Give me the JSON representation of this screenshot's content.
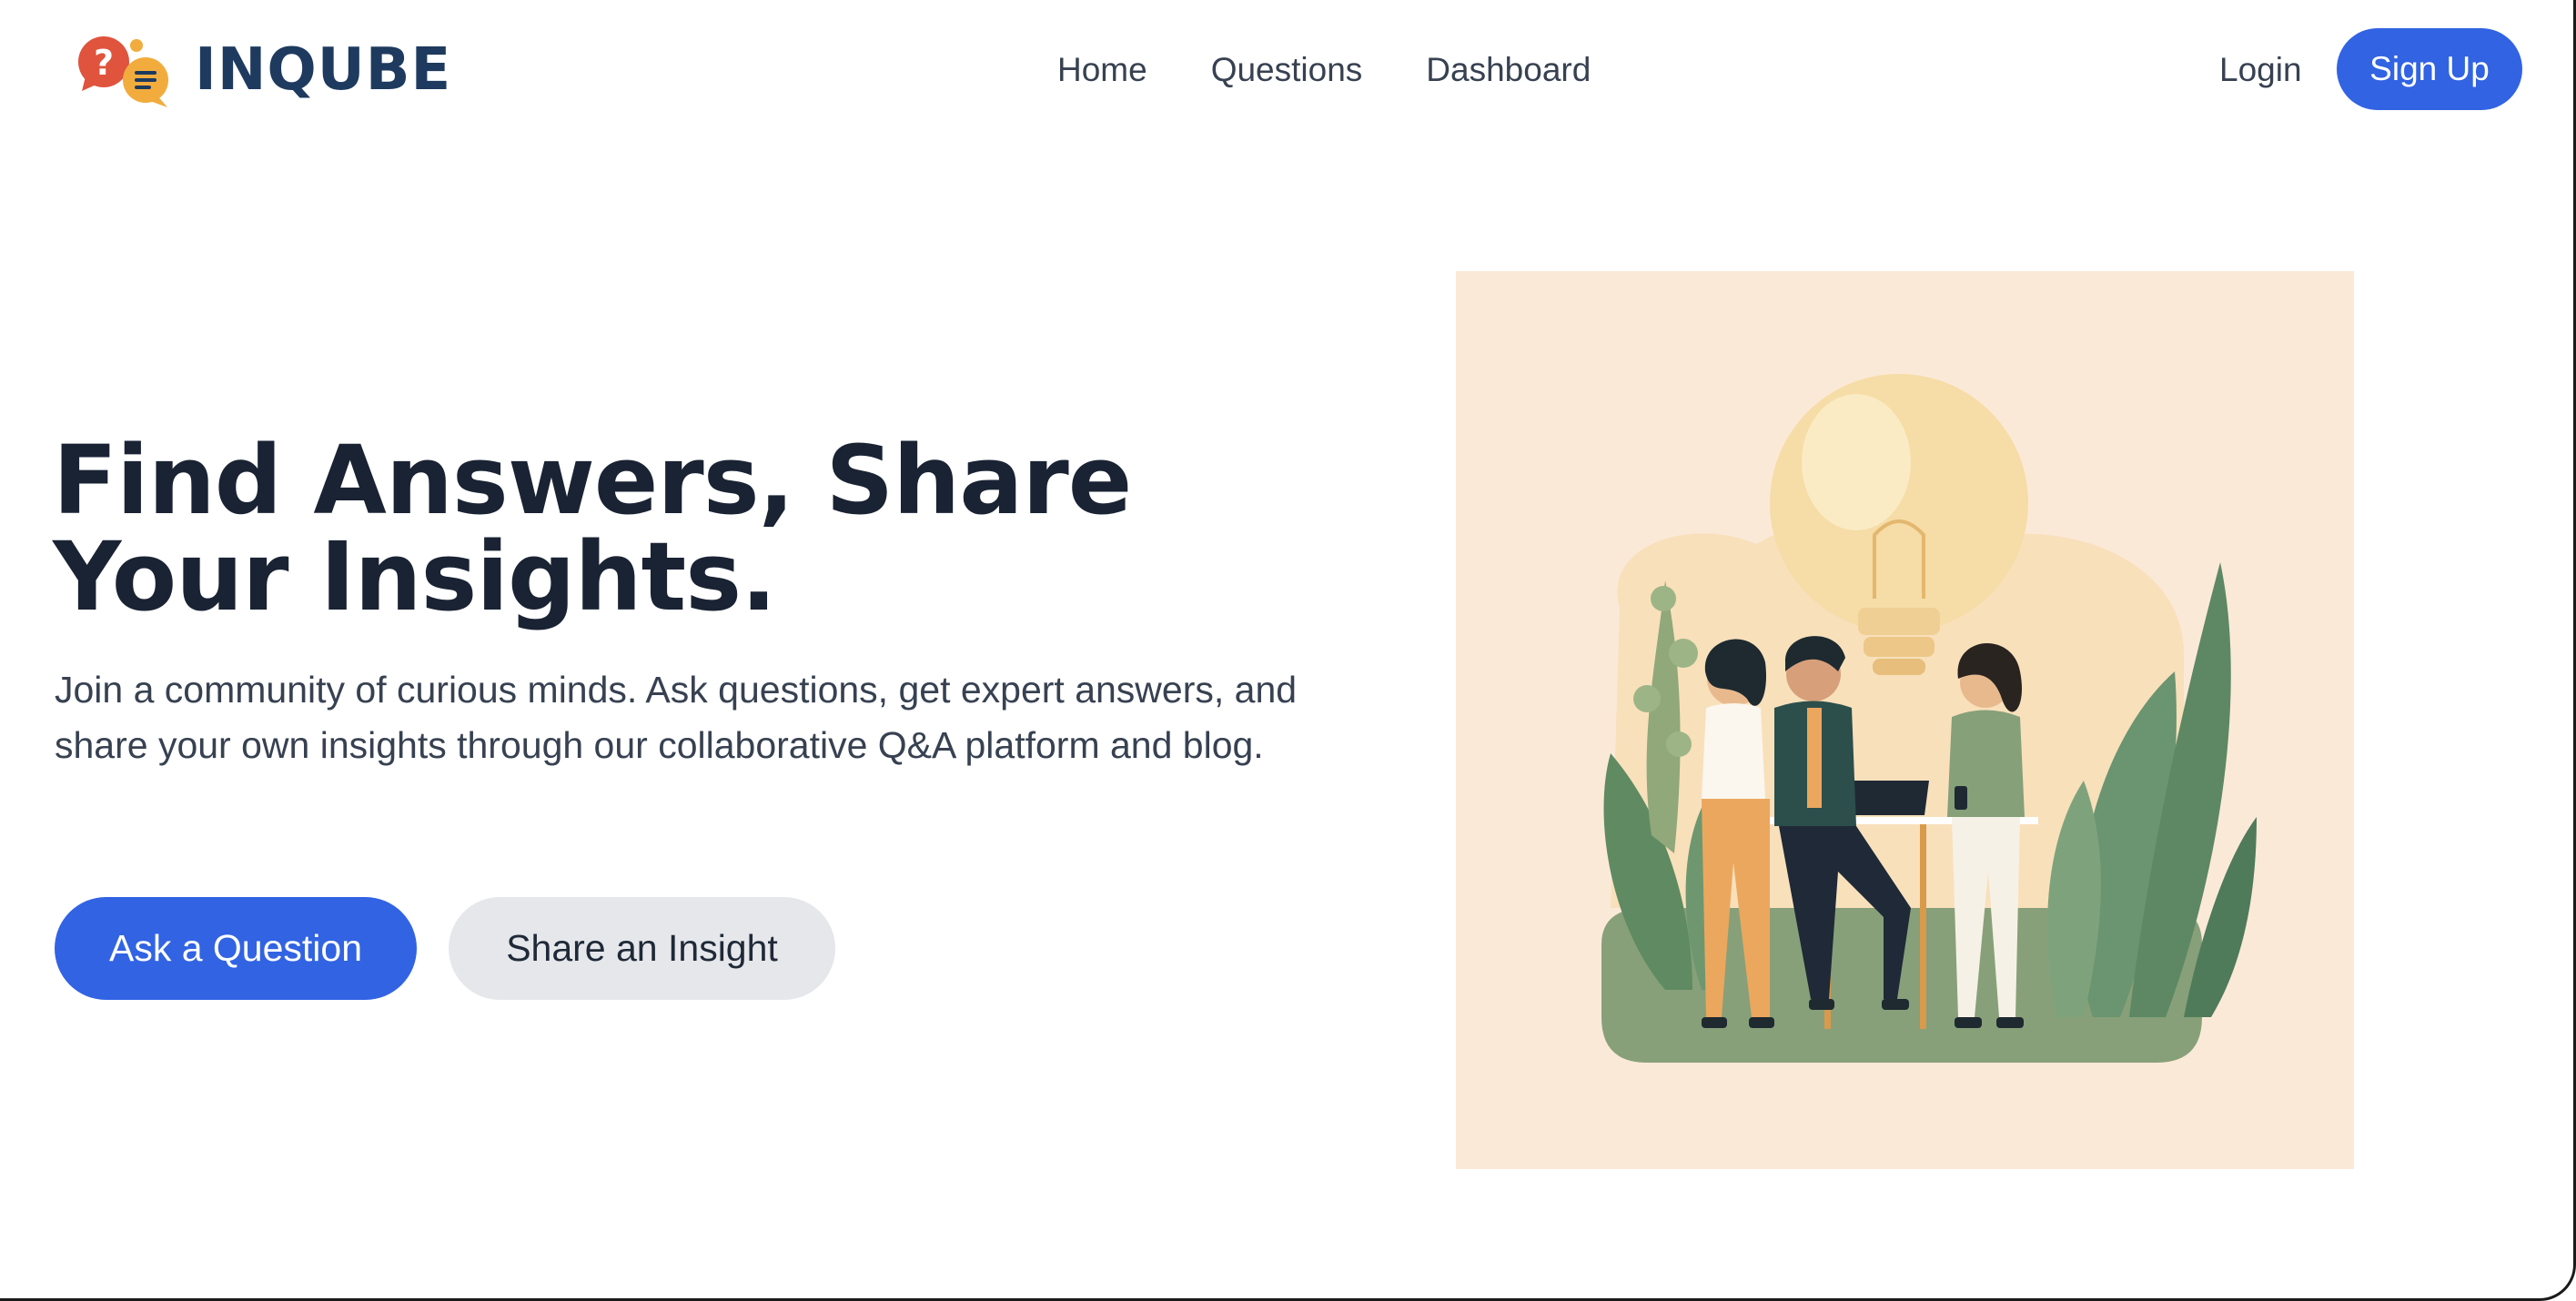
{
  "brand": {
    "name": "INQUBE"
  },
  "nav": {
    "items": [
      {
        "label": "Home"
      },
      {
        "label": "Questions"
      },
      {
        "label": "Dashboard"
      }
    ],
    "login_label": "Login",
    "signup_label": "Sign Up"
  },
  "hero": {
    "headline": "Find Answers, Share Your Insights.",
    "subtext": "Join a community of curious minds. Ask questions, get expert answers, and share your own insights through our collaborative Q&A platform and blog.",
    "primary_button": "Ask a Question",
    "secondary_button": "Share an Insight"
  },
  "colors": {
    "accent": "#3163e3",
    "brand_text": "#1e3a5f",
    "illustration_bg": "#fbe9d8"
  },
  "icons": {
    "logo": "chat-bubbles-question-icon"
  }
}
